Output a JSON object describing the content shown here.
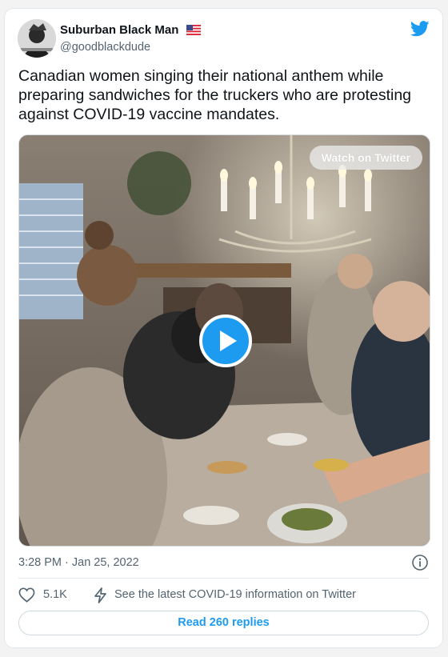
{
  "tweet": {
    "author": {
      "display_name": "Suburban Black Man",
      "handle": "@goodblackdude",
      "flag_icon": "us-flag-icon"
    },
    "text": "Canadian women singing their national anthem while preparing sandwiches for the truckers who are protesting against COVID-19 vaccine mandates.",
    "media": {
      "type": "video",
      "watch_label": "Watch on Twitter",
      "play_icon": "play-icon"
    },
    "timestamp": "3:28 PM · Jan 25, 2022",
    "likes": "5.1K",
    "covid_info_label": "See the latest COVID-19 information on Twitter",
    "replies_label": "Read 260 replies"
  },
  "colors": {
    "twitter_blue": "#1d9bf0",
    "text_primary": "#0f1419",
    "text_secondary": "#536471",
    "border": "#e1e8ed"
  }
}
